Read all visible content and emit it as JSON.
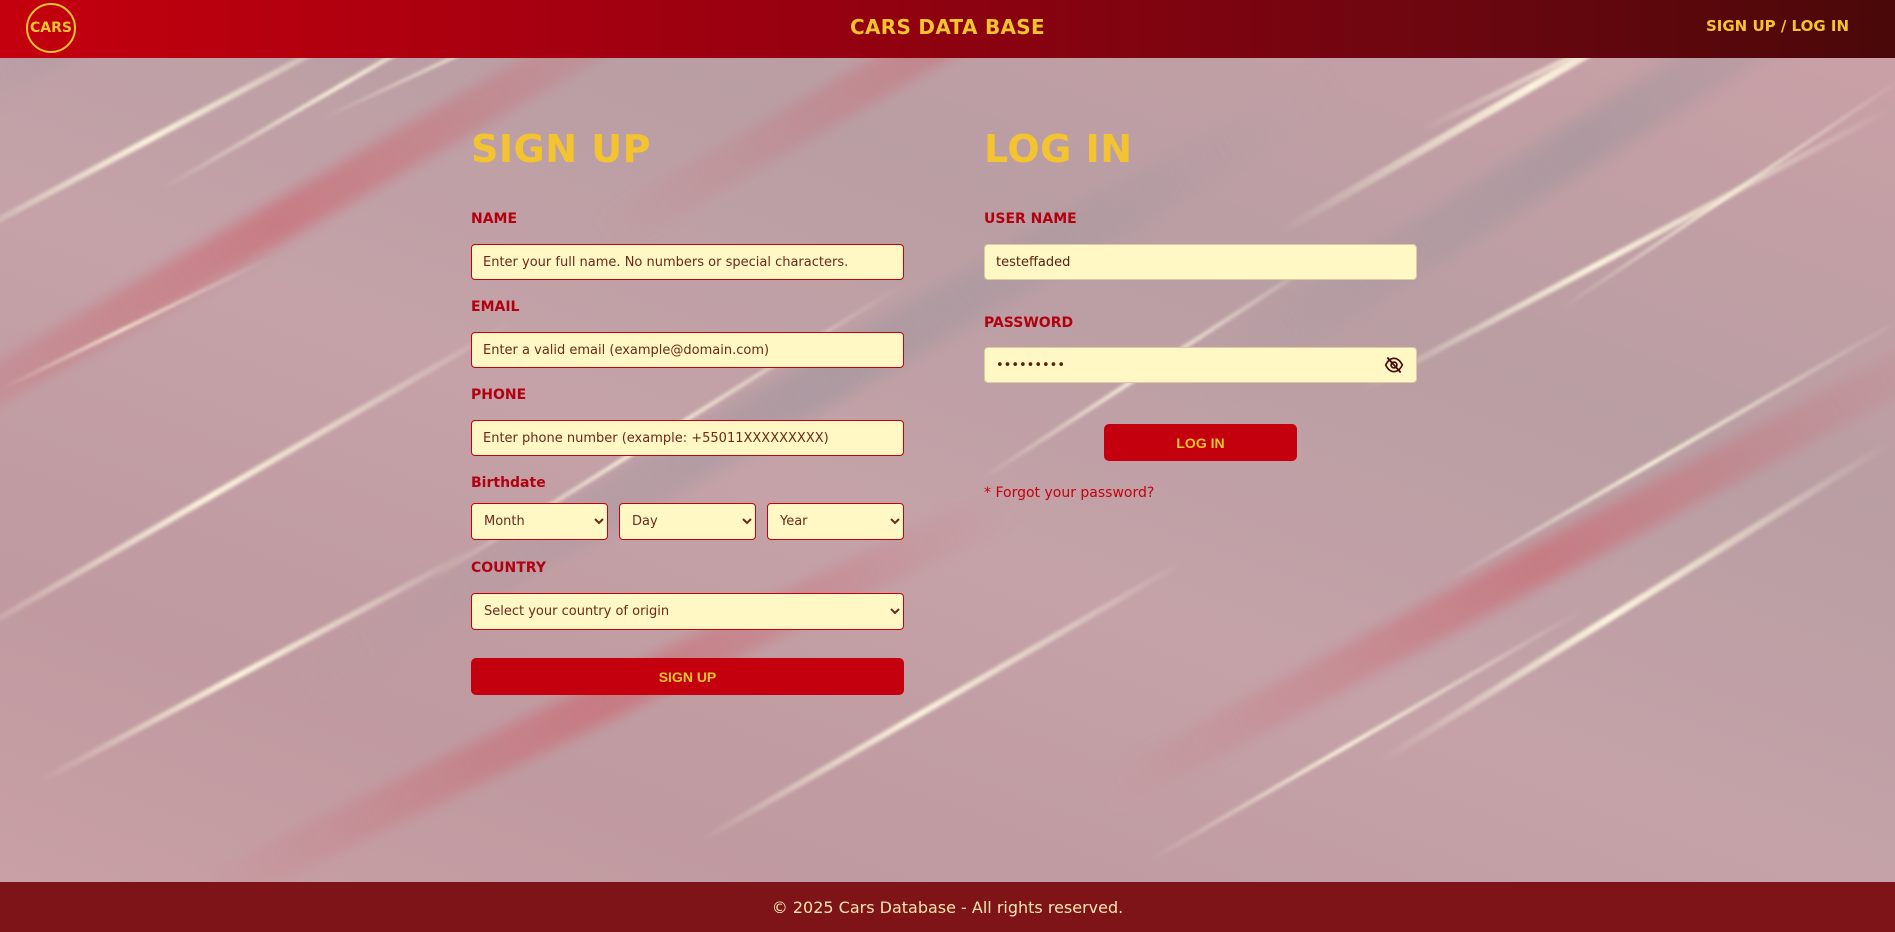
{
  "header": {
    "logo_text": "CARS",
    "title": "CARS DATA BASE",
    "nav_link": "SIGN UP / LOG IN"
  },
  "signup": {
    "title": "SIGN UP",
    "name_label": "NAME",
    "name_placeholder": "Enter your full name. No numbers or special characters.",
    "email_label": "EMAIL",
    "email_placeholder": "Enter a valid email (example@domain.com)",
    "phone_label": "PHONE",
    "phone_placeholder": "Enter phone number (example: +55011XXXXXXXXX)",
    "birthdate_label": "Birthdate",
    "month_option": "Month",
    "day_option": "Day",
    "year_option": "Year",
    "country_label": "COUNTRY",
    "country_option": "Select your country of origin",
    "button": "SIGN UP"
  },
  "login": {
    "title": "LOG IN",
    "username_label": "USER NAME",
    "username_value": "testeffaded",
    "password_label": "PASSWORD",
    "password_value": "•••••••••",
    "password_toggle_icon": "eye-slash-icon",
    "button": "LOG IN",
    "forgot": "* Forgot your password?"
  },
  "footer": {
    "text": "© 2025 Cars Database - All rights reserved."
  },
  "colors": {
    "brand_red": "#c4000e",
    "accent_yellow": "#f4c430",
    "input_bg": "#fff7c4",
    "footer_bg": "#7f1418"
  }
}
